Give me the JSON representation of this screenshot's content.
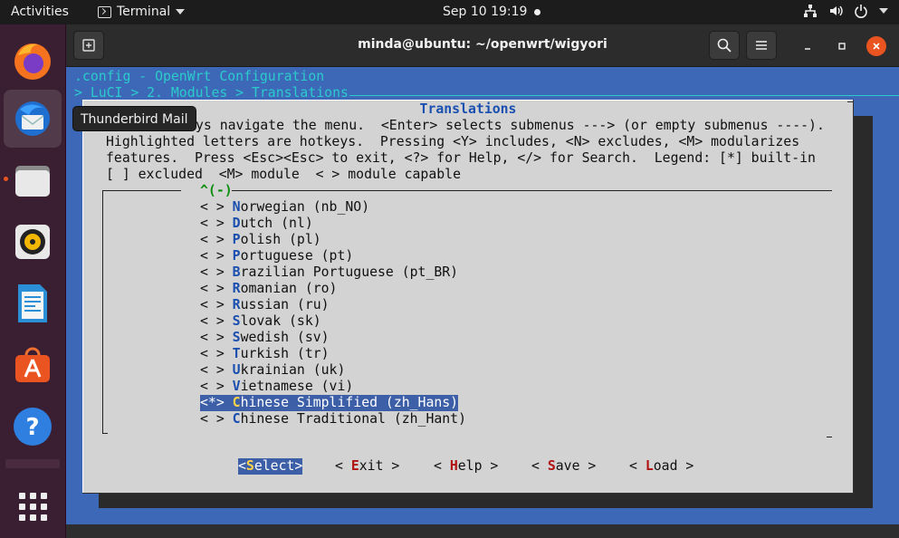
{
  "topbar": {
    "activities": "Activities",
    "app_menu": "Terminal",
    "clock": "Sep 10  19:19"
  },
  "dock": {
    "tooltip": "Thunderbird Mail",
    "items": [
      "firefox-icon",
      "thunderbird-icon",
      "files-icon",
      "rhythmbox-icon",
      "libreoffice-writer-icon",
      "software-icon",
      "help-icon",
      "show-apps-icon"
    ]
  },
  "window": {
    "title": "minda@ubuntu: ~/openwrt/wigyori"
  },
  "menuconfig": {
    "config_title": ".config - OpenWrt Configuration",
    "breadcrumb": "> LuCI > 2. Modules > Translations ",
    "dialog_title": "Translations",
    "help_lines": [
      "Arrow keys navigate the menu.  <Enter> selects submenus ---> (or empty submenus ----).",
      "Highlighted letters are hotkeys.  Pressing <Y> includes, <N> excludes, <M> modularizes",
      "features.  Press <Esc><Esc> to exit, <?> for Help, </> for Search.  Legend: [*] built-in",
      "[ ] excluded  <M> module  < > module capable"
    ],
    "help_line0_visible": "ys navigate the menu.  <Enter> selects submenus ---> (or empty submenus ----).",
    "scroll_indicator": "^(-)",
    "items": [
      {
        "mark": "< > ",
        "hotkey": "N",
        "rest": "orwegian (nb_NO)",
        "selected": false
      },
      {
        "mark": "< > ",
        "hotkey": "D",
        "rest": "utch (nl)",
        "selected": false
      },
      {
        "mark": "< > ",
        "hotkey": "P",
        "rest": "olish (pl)",
        "selected": false
      },
      {
        "mark": "< > ",
        "hotkey": "P",
        "rest": "ortuguese (pt)",
        "selected": false
      },
      {
        "mark": "< > ",
        "hotkey": "B",
        "rest": "razilian Portuguese (pt_BR)",
        "selected": false
      },
      {
        "mark": "< > ",
        "hotkey": "R",
        "rest": "omanian (ro)",
        "selected": false
      },
      {
        "mark": "< > ",
        "hotkey": "R",
        "rest": "ussian (ru)",
        "selected": false
      },
      {
        "mark": "< > ",
        "hotkey": "S",
        "rest": "lovak (sk)",
        "selected": false
      },
      {
        "mark": "< > ",
        "hotkey": "S",
        "rest": "wedish (sv)",
        "selected": false
      },
      {
        "mark": "< > ",
        "hotkey": "T",
        "rest": "urkish (tr)",
        "selected": false
      },
      {
        "mark": "< > ",
        "hotkey": "U",
        "rest": "krainian (uk)",
        "selected": false
      },
      {
        "mark": "< > ",
        "hotkey": "V",
        "rest": "ietnamese (vi)",
        "selected": false
      },
      {
        "mark": "<*> ",
        "hotkey": "C",
        "rest": "hinese Simplified (zh_Hans)",
        "selected": true
      },
      {
        "mark": "< > ",
        "hotkey": "C",
        "rest": "hinese Traditional (zh_Hant)",
        "selected": false
      }
    ],
    "buttons": [
      {
        "pre": "<",
        "hotkey": "S",
        "rest": "elect>",
        "selected": true
      },
      {
        "pre": "< ",
        "hotkey": "E",
        "rest": "xit >",
        "selected": false
      },
      {
        "pre": "< ",
        "hotkey": "H",
        "rest": "elp >",
        "selected": false
      },
      {
        "pre": "< ",
        "hotkey": "S",
        "rest": "ave >",
        "selected": false
      },
      {
        "pre": "< ",
        "hotkey": "L",
        "rest": "oad >",
        "selected": false
      }
    ]
  },
  "colors": {
    "terminal_bg": "#3d68b8",
    "dialog_bg": "#d3d3d3",
    "header_cyan": "#2bcbcb",
    "selection": "#3c5fa8",
    "hotkey_blue": "#1a4fb0",
    "hotkey_red": "#b01010",
    "close_button": "#e95420"
  }
}
